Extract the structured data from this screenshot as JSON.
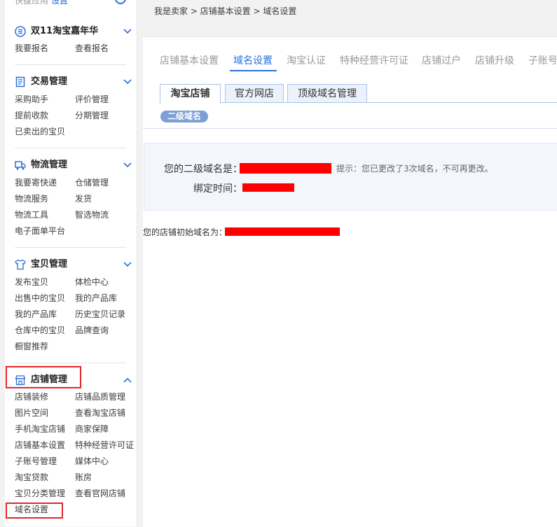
{
  "sidebar": {
    "top_text": "快捷应用",
    "top_settings": "设置",
    "sections": [
      {
        "title": "双11淘宝嘉年华",
        "icon": "list-icon",
        "links": [
          "我要报名",
          "查看报名"
        ]
      },
      {
        "title": "交易管理",
        "icon": "document-icon",
        "links": [
          "采购助手",
          "评价管理",
          "提前收款",
          "分期管理",
          "已卖出的宝贝"
        ]
      },
      {
        "title": "物流管理",
        "icon": "truck-icon",
        "links": [
          "我要寄快递",
          "仓储管理",
          "物流服务",
          "发货",
          "物流工具",
          "智选物流",
          "电子面单平台"
        ]
      },
      {
        "title": "宝贝管理",
        "icon": "shirt-icon",
        "links": [
          "发布宝贝",
          "体检中心",
          "出售中的宝贝",
          "我的产品库",
          "我的产品库",
          "历史宝贝记录",
          "仓库中的宝贝",
          "品牌查询",
          "橱窗推荐"
        ]
      },
      {
        "title": "店铺管理",
        "icon": "store-icon",
        "links": [
          "店铺装修",
          "店铺品质管理",
          "图片空间",
          "查看淘宝店铺",
          "手机淘宝店铺",
          "商家保障",
          "店铺基本设置",
          "特种经营许可证",
          "子账号管理",
          "媒体中心",
          "淘宝贷款",
          "账房",
          "宝贝分类管理",
          "查看官网店铺",
          "域名设置"
        ]
      }
    ]
  },
  "breadcrumb": "我是卖家 > 店铺基本设置 > 域名设置",
  "top_tabs": [
    "店铺基本设置",
    "域名设置",
    "淘宝认证",
    "特种经营许可证",
    "店铺过户",
    "店铺升级",
    "子账号"
  ],
  "sub_tabs": [
    "淘宝店铺",
    "官方网店",
    "顶级域名管理"
  ],
  "pill": "二级域名",
  "info": {
    "domain_label": "您的二级域名是：",
    "hint": "提示：您已更改了3次域名，不可再更改。",
    "bind_label": "绑定时间："
  },
  "initial_domain_label": "您的店铺初始域名为：",
  "colors": {
    "accent": "#2a6fdb",
    "highlight": "#e4262a",
    "redaction": "#ff0000"
  }
}
